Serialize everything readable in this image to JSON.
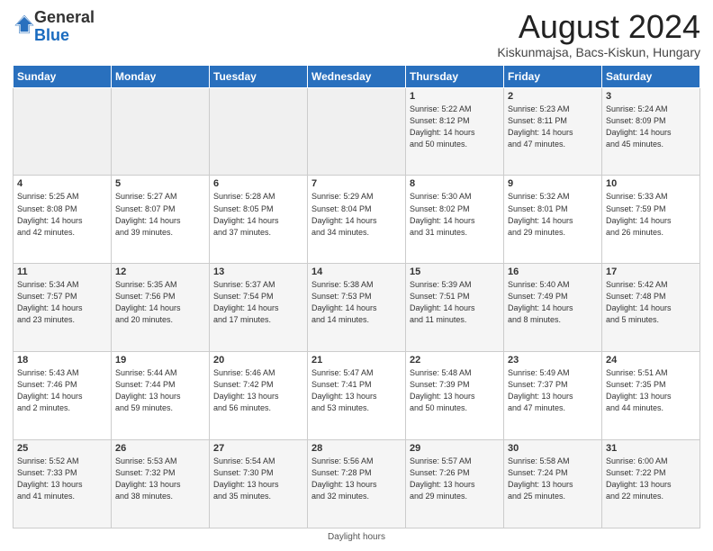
{
  "header": {
    "logo_general": "General",
    "logo_blue": "Blue",
    "main_title": "August 2024",
    "subtitle": "Kiskunmajsa, Bacs-Kiskun, Hungary"
  },
  "days_of_week": [
    "Sunday",
    "Monday",
    "Tuesday",
    "Wednesday",
    "Thursday",
    "Friday",
    "Saturday"
  ],
  "footer": {
    "daylight_hours_label": "Daylight hours"
  },
  "weeks": [
    [
      {
        "day": "",
        "info": ""
      },
      {
        "day": "",
        "info": ""
      },
      {
        "day": "",
        "info": ""
      },
      {
        "day": "",
        "info": ""
      },
      {
        "day": "1",
        "info": "Sunrise: 5:22 AM\nSunset: 8:12 PM\nDaylight: 14 hours\nand 50 minutes."
      },
      {
        "day": "2",
        "info": "Sunrise: 5:23 AM\nSunset: 8:11 PM\nDaylight: 14 hours\nand 47 minutes."
      },
      {
        "day": "3",
        "info": "Sunrise: 5:24 AM\nSunset: 8:09 PM\nDaylight: 14 hours\nand 45 minutes."
      }
    ],
    [
      {
        "day": "4",
        "info": "Sunrise: 5:25 AM\nSunset: 8:08 PM\nDaylight: 14 hours\nand 42 minutes."
      },
      {
        "day": "5",
        "info": "Sunrise: 5:27 AM\nSunset: 8:07 PM\nDaylight: 14 hours\nand 39 minutes."
      },
      {
        "day": "6",
        "info": "Sunrise: 5:28 AM\nSunset: 8:05 PM\nDaylight: 14 hours\nand 37 minutes."
      },
      {
        "day": "7",
        "info": "Sunrise: 5:29 AM\nSunset: 8:04 PM\nDaylight: 14 hours\nand 34 minutes."
      },
      {
        "day": "8",
        "info": "Sunrise: 5:30 AM\nSunset: 8:02 PM\nDaylight: 14 hours\nand 31 minutes."
      },
      {
        "day": "9",
        "info": "Sunrise: 5:32 AM\nSunset: 8:01 PM\nDaylight: 14 hours\nand 29 minutes."
      },
      {
        "day": "10",
        "info": "Sunrise: 5:33 AM\nSunset: 7:59 PM\nDaylight: 14 hours\nand 26 minutes."
      }
    ],
    [
      {
        "day": "11",
        "info": "Sunrise: 5:34 AM\nSunset: 7:57 PM\nDaylight: 14 hours\nand 23 minutes."
      },
      {
        "day": "12",
        "info": "Sunrise: 5:35 AM\nSunset: 7:56 PM\nDaylight: 14 hours\nand 20 minutes."
      },
      {
        "day": "13",
        "info": "Sunrise: 5:37 AM\nSunset: 7:54 PM\nDaylight: 14 hours\nand 17 minutes."
      },
      {
        "day": "14",
        "info": "Sunrise: 5:38 AM\nSunset: 7:53 PM\nDaylight: 14 hours\nand 14 minutes."
      },
      {
        "day": "15",
        "info": "Sunrise: 5:39 AM\nSunset: 7:51 PM\nDaylight: 14 hours\nand 11 minutes."
      },
      {
        "day": "16",
        "info": "Sunrise: 5:40 AM\nSunset: 7:49 PM\nDaylight: 14 hours\nand 8 minutes."
      },
      {
        "day": "17",
        "info": "Sunrise: 5:42 AM\nSunset: 7:48 PM\nDaylight: 14 hours\nand 5 minutes."
      }
    ],
    [
      {
        "day": "18",
        "info": "Sunrise: 5:43 AM\nSunset: 7:46 PM\nDaylight: 14 hours\nand 2 minutes."
      },
      {
        "day": "19",
        "info": "Sunrise: 5:44 AM\nSunset: 7:44 PM\nDaylight: 13 hours\nand 59 minutes."
      },
      {
        "day": "20",
        "info": "Sunrise: 5:46 AM\nSunset: 7:42 PM\nDaylight: 13 hours\nand 56 minutes."
      },
      {
        "day": "21",
        "info": "Sunrise: 5:47 AM\nSunset: 7:41 PM\nDaylight: 13 hours\nand 53 minutes."
      },
      {
        "day": "22",
        "info": "Sunrise: 5:48 AM\nSunset: 7:39 PM\nDaylight: 13 hours\nand 50 minutes."
      },
      {
        "day": "23",
        "info": "Sunrise: 5:49 AM\nSunset: 7:37 PM\nDaylight: 13 hours\nand 47 minutes."
      },
      {
        "day": "24",
        "info": "Sunrise: 5:51 AM\nSunset: 7:35 PM\nDaylight: 13 hours\nand 44 minutes."
      }
    ],
    [
      {
        "day": "25",
        "info": "Sunrise: 5:52 AM\nSunset: 7:33 PM\nDaylight: 13 hours\nand 41 minutes."
      },
      {
        "day": "26",
        "info": "Sunrise: 5:53 AM\nSunset: 7:32 PM\nDaylight: 13 hours\nand 38 minutes."
      },
      {
        "day": "27",
        "info": "Sunrise: 5:54 AM\nSunset: 7:30 PM\nDaylight: 13 hours\nand 35 minutes."
      },
      {
        "day": "28",
        "info": "Sunrise: 5:56 AM\nSunset: 7:28 PM\nDaylight: 13 hours\nand 32 minutes."
      },
      {
        "day": "29",
        "info": "Sunrise: 5:57 AM\nSunset: 7:26 PM\nDaylight: 13 hours\nand 29 minutes."
      },
      {
        "day": "30",
        "info": "Sunrise: 5:58 AM\nSunset: 7:24 PM\nDaylight: 13 hours\nand 25 minutes."
      },
      {
        "day": "31",
        "info": "Sunrise: 6:00 AM\nSunset: 7:22 PM\nDaylight: 13 hours\nand 22 minutes."
      }
    ]
  ]
}
